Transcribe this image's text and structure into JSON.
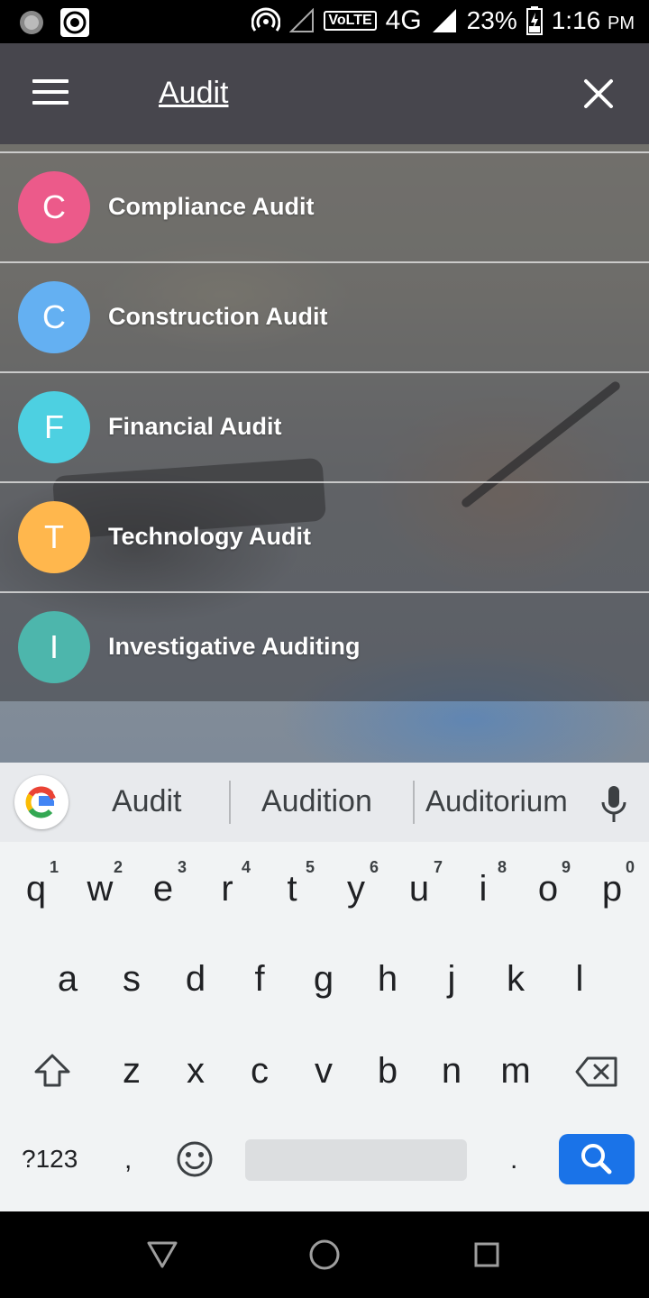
{
  "status_bar": {
    "battery": "23%",
    "time": "1:16",
    "ampm": "PM",
    "volte": "VoLTE",
    "network": "4G",
    "network_small": "4G"
  },
  "app_bar": {
    "search_value": "Audit",
    "icons": [
      "menu-icon",
      "close-icon"
    ]
  },
  "results": [
    {
      "initial": "C",
      "label": "Compliance Audit",
      "color": "#ec5a8a"
    },
    {
      "initial": "C",
      "label": "Construction Audit",
      "color": "#64b0f2"
    },
    {
      "initial": "F",
      "label": "Financial Audit",
      "color": "#4dd0e1"
    },
    {
      "initial": "T",
      "label": "Technology Audit",
      "color": "#ffb74d"
    },
    {
      "initial": "I",
      "label": "Investigative Auditing",
      "color": "#4db6ac"
    }
  ],
  "keyboard": {
    "suggestions": [
      "Audit",
      "Audition",
      "Auditorium"
    ],
    "row1": [
      "q",
      "w",
      "e",
      "r",
      "t",
      "y",
      "u",
      "i",
      "o",
      "p"
    ],
    "row1_hints": [
      "1",
      "2",
      "3",
      "4",
      "5",
      "6",
      "7",
      "8",
      "9",
      "0"
    ],
    "row2": [
      "a",
      "s",
      "d",
      "f",
      "g",
      "h",
      "j",
      "k",
      "l"
    ],
    "row3": [
      "z",
      "x",
      "c",
      "v",
      "b",
      "n",
      "m"
    ],
    "symbols_label": "?123",
    "comma": ",",
    "period": ".",
    "accent_color": "#1a73e8"
  }
}
